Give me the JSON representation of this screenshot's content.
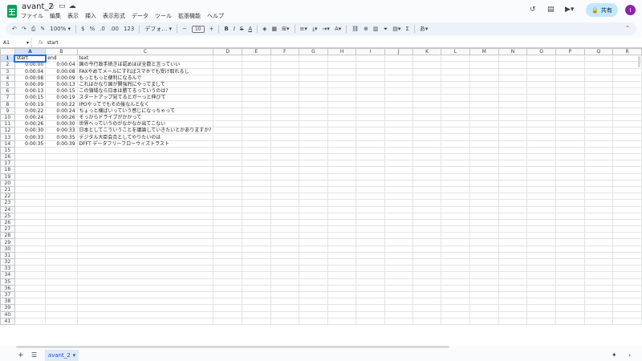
{
  "app": {
    "doc_title": "avant_2"
  },
  "menu": [
    "ファイル",
    "編集",
    "表示",
    "挿入",
    "表示形式",
    "データ",
    "ツール",
    "拡張機能",
    "ヘルプ"
  ],
  "header_right": {
    "share_label": "共有",
    "avatar_letter": "I"
  },
  "toolbar": {
    "zoom": "100%",
    "currency": "$",
    "percent": "%",
    "dec_less": ".0",
    "dec_more": ".00",
    "number_format": "123",
    "font": "デフォ…",
    "font_size": "10"
  },
  "formula_bar": {
    "cell_ref": "A1",
    "fx": "fx",
    "value": "start"
  },
  "columns": [
    "A",
    "B",
    "C",
    "D",
    "E",
    "F",
    "G",
    "H",
    "I",
    "J",
    "K",
    "L",
    "M",
    "N",
    "O",
    "P",
    "Q",
    "R"
  ],
  "rows": [
    [
      "start",
      "end",
      "text"
    ],
    [
      "0:00:00",
      "0:00:04",
      "国の今行政手続きは認めほぼ全数と言っていい"
    ],
    [
      "0:00:04",
      "0:00:08",
      "FAXやめてメールにすればスマホでも受け取れるし"
    ],
    [
      "0:00:08",
      "0:00:09",
      "もっともっと便利になるんで"
    ],
    [
      "0:00:09",
      "0:00:13",
      "これはかなり国が関強烈にやってまして"
    ],
    [
      "0:00:13",
      "0:00:15",
      "この領域なら日本は勝てるっていうのは?"
    ],
    [
      "0:00:15",
      "0:00:19",
      "スタートアップ見てるとガーっと伸びて"
    ],
    [
      "0:00:19",
      "0:00:22",
      "IPOやってでもその後なんとなく"
    ],
    [
      "0:00:22",
      "0:00:24",
      "ちょっと横ばいっていう感じになっちゃって"
    ],
    [
      "0:00:24",
      "0:00:26",
      "そっからドライブがかかって"
    ],
    [
      "0:00:26",
      "0:00:30",
      "世界へっていうのがなかなか出てこない"
    ],
    [
      "0:00:30",
      "0:00:33",
      "日本としてこういうことを議論していきたいとかありますか?"
    ],
    [
      "0:00:33",
      "0:00:35",
      "デジタル大臣会合としてやりたいのは"
    ],
    [
      "0:00:35",
      "0:00:39",
      "DFFT データフリーフローウィズトラスト"
    ]
  ],
  "total_rows": 41,
  "sheet_tab": "avant_2"
}
